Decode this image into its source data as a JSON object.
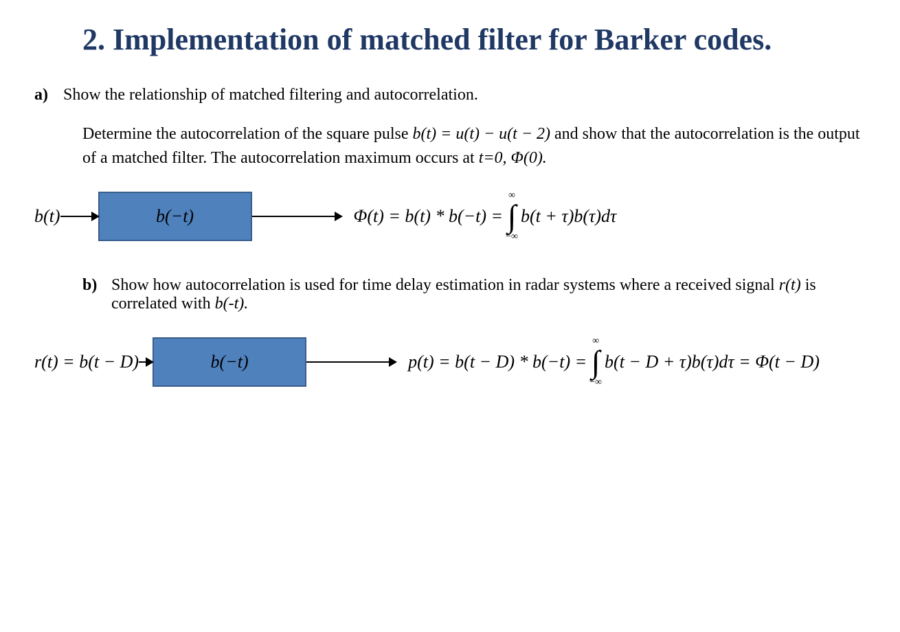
{
  "title": "2. Implementation of matched filter for Barker codes.",
  "a": {
    "marker": "a)",
    "lead": "Show the relationship of matched filtering and autocorrelation.",
    "para_pre": "Determine the autocorrelation of the square pulse ",
    "pulse_def": "b(t) = u(t) − u(t − 2)",
    "para_post": " and show that the autocorrelation is the output of a matched filter. The autocorrelation maximum occurs at ",
    "tail": "t=0, Φ(0)."
  },
  "diag1": {
    "input": "b(t)",
    "block": "b(−t)",
    "out_lhs": "Φ(t) = b(t) * b(−t) =",
    "int_upper": "∞",
    "int_lower": "−∞",
    "int_body": "b(t + τ)b(τ)dτ"
  },
  "b": {
    "marker": "b)",
    "text_pre": "Show how autocorrelation is used for time delay estimation in radar systems where a received signal ",
    "rt": "r(t)",
    "text_mid": " is correlated with ",
    "bmt": "b(-t).",
    "text_post": ""
  },
  "diag2": {
    "input": "r(t) = b(t − D)",
    "block": "b(−t)",
    "out_lhs": "p(t) = b(t − D) * b(−t) =",
    "int_upper": "∞",
    "int_lower": "−∞",
    "int_body": "b(t − D + τ)b(τ)dτ = Φ(t − D)"
  }
}
